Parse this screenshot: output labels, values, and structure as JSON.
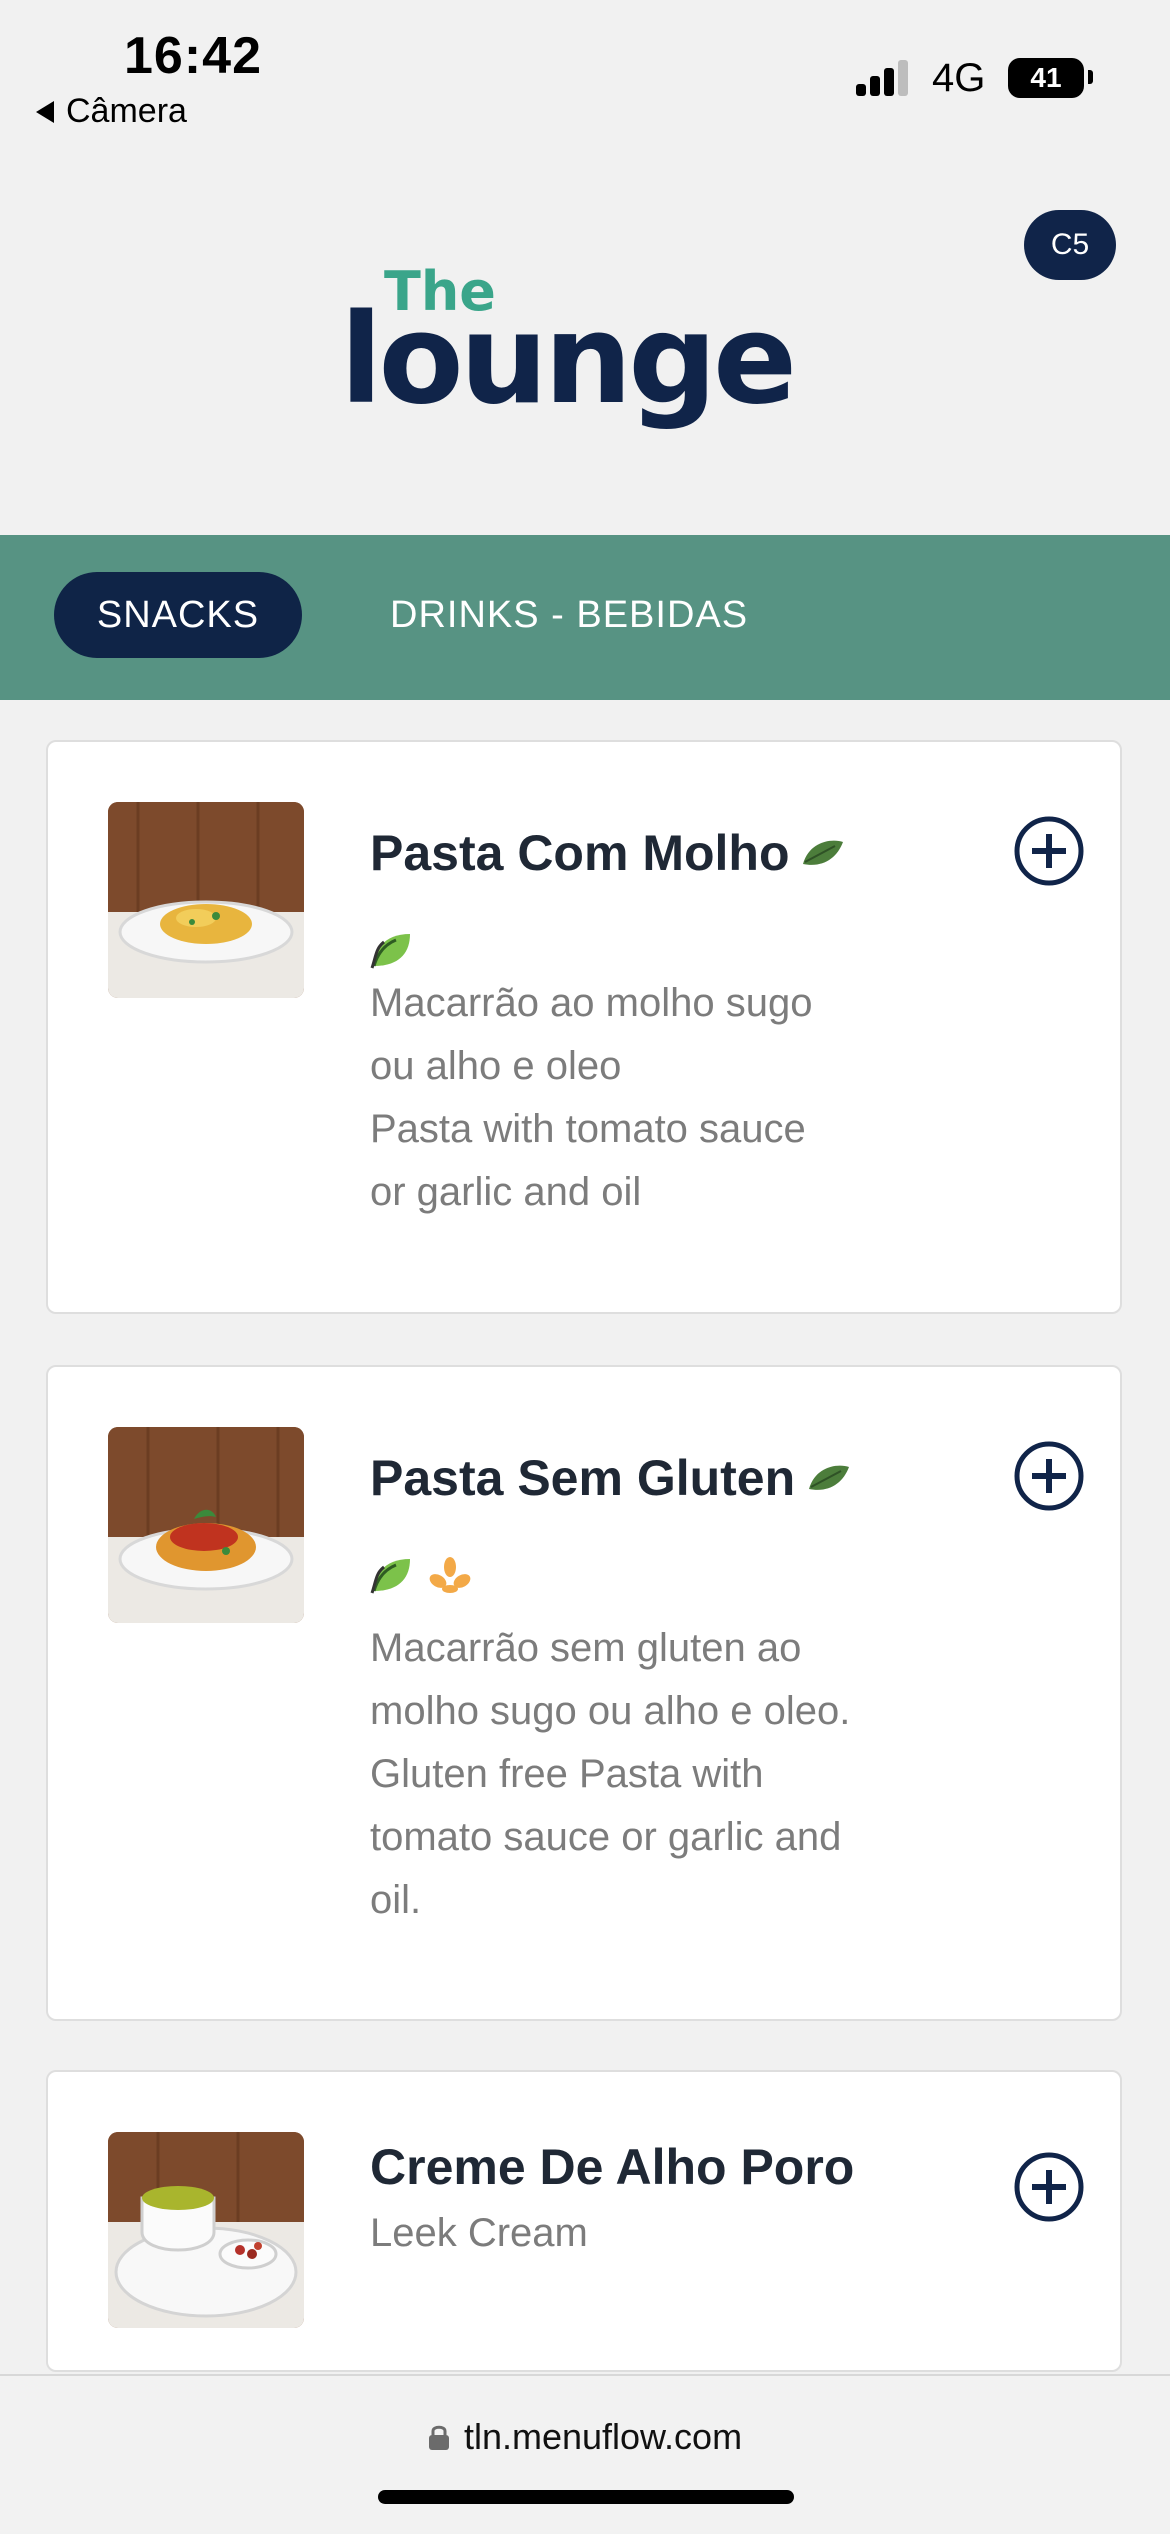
{
  "status_bar": {
    "time": "16:42",
    "back_label": "Câmera",
    "network": "4G",
    "battery": "41"
  },
  "header": {
    "table_code": "C5",
    "logo_top": "The",
    "logo_bottom": "lounge",
    "logo_top_color": "#3aa58a",
    "logo_bottom_color": "#102449"
  },
  "categories": [
    {
      "label": "SNACKS",
      "active": true
    },
    {
      "label": "DRINKS - BEBIDAS",
      "active": false
    }
  ],
  "menu_items": [
    {
      "title": "Pasta Com Molho",
      "badges": [
        "leaf-icon"
      ],
      "description": [
        "Macarrão ao molho sugo",
        "ou alho e oleo",
        "Pasta with tomato sauce",
        "or garlic and oil"
      ]
    },
    {
      "title": "Pasta Sem Gluten",
      "badges": [
        "leaf-icon",
        "wheat-icon"
      ],
      "description": [
        "Macarrão sem gluten ao",
        "molho sugo ou alho e oleo.",
        "Gluten free Pasta with",
        "tomato sauce or garlic and",
        "oil."
      ]
    },
    {
      "title": "Creme De Alho Poro",
      "badges": [],
      "description": [
        "Leek Cream"
      ]
    }
  ],
  "browser": {
    "url": "tln.menuflow.com"
  },
  "colors": {
    "navy": "#102449",
    "teal": "#579383",
    "leaf": "#5a8f3c",
    "wheat": "#f0a54a"
  }
}
